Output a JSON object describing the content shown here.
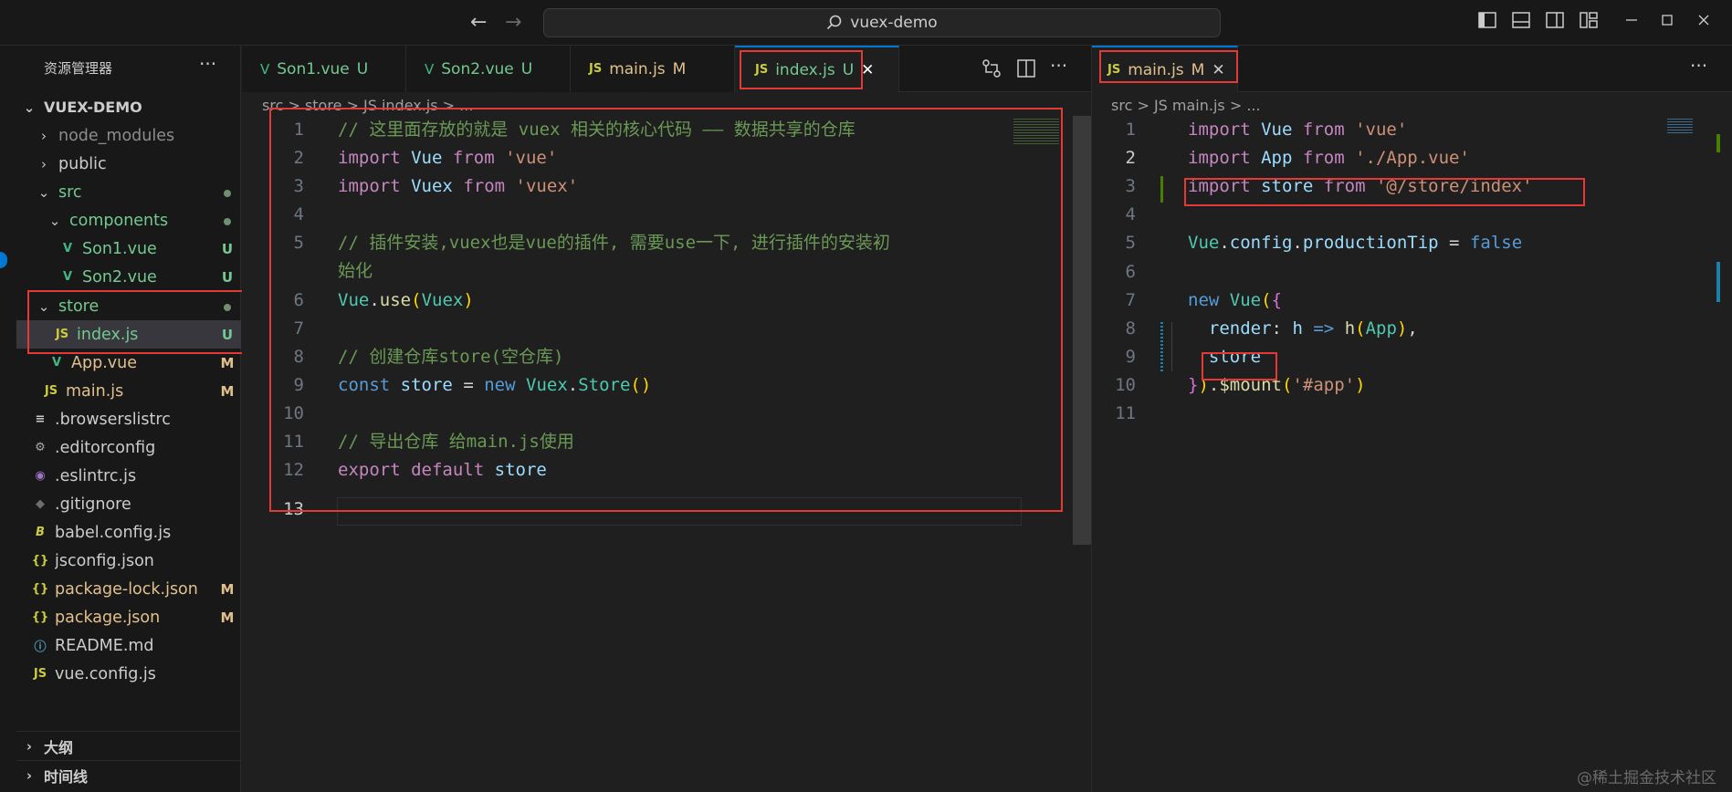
{
  "titlebar": {
    "search_text": "vuex-demo",
    "back": "←",
    "forward": "→"
  },
  "sidebar": {
    "title": "资源管理器",
    "more": "···",
    "project": "VUEX-DEMO",
    "items": [
      {
        "label": "node_modules",
        "badge": ""
      },
      {
        "label": "public",
        "badge": ""
      },
      {
        "label": "src",
        "badge": ""
      },
      {
        "label": "components",
        "badge": ""
      },
      {
        "label": "Son1.vue",
        "badge": "U"
      },
      {
        "label": "Son2.vue",
        "badge": "U"
      },
      {
        "label": "store",
        "badge": ""
      },
      {
        "label": "index.js",
        "badge": "U"
      },
      {
        "label": "App.vue",
        "badge": "M"
      },
      {
        "label": "main.js",
        "badge": "M"
      },
      {
        "label": ".browserslistrc",
        "badge": ""
      },
      {
        "label": ".editorconfig",
        "badge": ""
      },
      {
        "label": ".eslintrc.js",
        "badge": ""
      },
      {
        "label": ".gitignore",
        "badge": ""
      },
      {
        "label": "babel.config.js",
        "badge": ""
      },
      {
        "label": "jsconfig.json",
        "badge": ""
      },
      {
        "label": "package-lock.json",
        "badge": "M"
      },
      {
        "label": "package.json",
        "badge": "M"
      },
      {
        "label": "README.md",
        "badge": ""
      },
      {
        "label": "vue.config.js",
        "badge": ""
      }
    ],
    "outline": "大纲",
    "timeline": "时间线"
  },
  "left_editor": {
    "tabs": [
      {
        "label": "Son1.vue",
        "badge": "U"
      },
      {
        "label": "Son2.vue",
        "badge": "U"
      },
      {
        "label": "main.js",
        "badge": "M"
      },
      {
        "label": "index.js",
        "badge": "U",
        "close": "✕"
      }
    ],
    "breadcrumb": "src > store > JS index.js > ...",
    "line_numbers": [
      "1",
      "2",
      "3",
      "4",
      "5",
      "",
      "6",
      "7",
      "8",
      "9",
      "10",
      "11",
      "12",
      "13"
    ]
  },
  "right_editor": {
    "tab": {
      "label": "main.js",
      "badge": "M",
      "close": "✕"
    },
    "breadcrumb": "src > JS main.js > ...",
    "line_numbers": [
      "1",
      "2",
      "3",
      "4",
      "5",
      "6",
      "7",
      "8",
      "9",
      "10",
      "11"
    ]
  },
  "watermark": "@稀土掘金技术社区"
}
